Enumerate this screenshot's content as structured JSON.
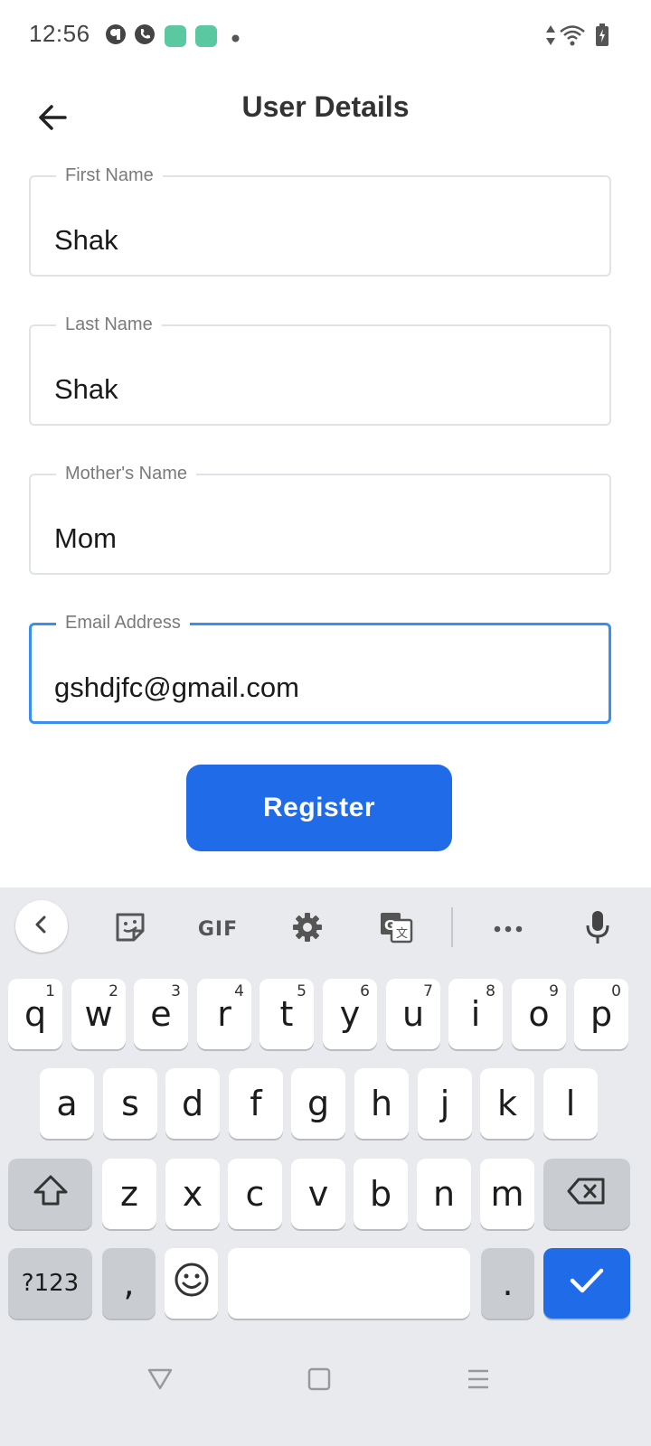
{
  "status_bar": {
    "time": "12:56",
    "icons": [
      "app-icon-1",
      "phone-icon",
      "app-icon-2",
      "app-icon-3",
      "dot-icon",
      "signal-arrows-icon",
      "wifi-icon",
      "battery-charging-icon"
    ]
  },
  "header": {
    "title": "User Details",
    "back_icon": "arrow-left-icon"
  },
  "form": {
    "first_name": {
      "label": "First Name",
      "value": "Shak"
    },
    "last_name": {
      "label": "Last Name",
      "value": "Shak"
    },
    "mothers_name": {
      "label": "Mother's Name",
      "value": "Mom"
    },
    "email": {
      "label": "Email Address",
      "value": "gshdjfc@gmail.com",
      "focused": true
    }
  },
  "register_button": {
    "label": "Register"
  },
  "colors": {
    "accent": "#1f6be8",
    "focus_border": "#3a8eef",
    "keyboard_bg": "#e8eaed"
  },
  "keyboard": {
    "toolbar": {
      "gif_label": "GIF"
    },
    "row1": [
      {
        "label": "q",
        "hint": "1"
      },
      {
        "label": "w",
        "hint": "2"
      },
      {
        "label": "e",
        "hint": "3"
      },
      {
        "label": "r",
        "hint": "4"
      },
      {
        "label": "t",
        "hint": "5"
      },
      {
        "label": "y",
        "hint": "6"
      },
      {
        "label": "u",
        "hint": "7"
      },
      {
        "label": "i",
        "hint": "8"
      },
      {
        "label": "o",
        "hint": "9"
      },
      {
        "label": "p",
        "hint": "0"
      }
    ],
    "row2": [
      "a",
      "s",
      "d",
      "f",
      "g",
      "h",
      "j",
      "k",
      "l"
    ],
    "row3": [
      "z",
      "x",
      "c",
      "v",
      "b",
      "n",
      "m"
    ],
    "symbols_label": "?123",
    "comma_label": ",",
    "period_label": "."
  }
}
